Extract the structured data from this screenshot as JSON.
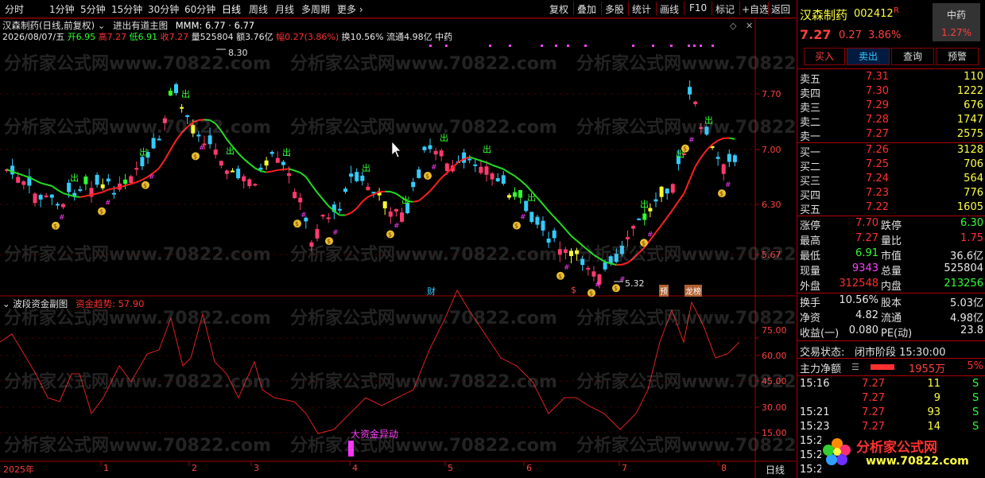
{
  "toolbar": {
    "periods": [
      "分时",
      "1分钟",
      "5分钟",
      "15分钟",
      "30分钟",
      "60分钟",
      "日线",
      "周线",
      "月线",
      "多周期",
      "更多"
    ],
    "active": "日线",
    "right_tools": [
      "复权",
      "叠加",
      "多股",
      "统计",
      "画线",
      "F10",
      "标记",
      "+自选",
      "返回"
    ]
  },
  "chart": {
    "title": "汉森制药(日线,前复权)",
    "indicator_name": "进出有道主图",
    "indicator_values": "MMM: 6.77 · 6.77",
    "info_date": "2026/08/07/五",
    "info_open": "开6.95",
    "info_high": "高7.27",
    "info_low": "低6.91",
    "info_close": "收7.27",
    "info_volume": "量525804",
    "info_amount": "额3.76亿",
    "info_range": "幅0.27(3.86%)",
    "info_turnover": "换10.56%",
    "info_float": "流通4.98亿",
    "info_industry": "中药",
    "y_labels": [
      "7.70",
      "7.00",
      "6.30",
      "5.67"
    ],
    "max_label": "8.30",
    "min_label": "5.32",
    "markers": [
      "财",
      "$",
      "预",
      "龙榜"
    ],
    "signal_chu": "出",
    "signal_money": "$",
    "signal_hash": "#"
  },
  "sub_chart": {
    "name": "波段资金副图",
    "indicator_label": "资金趋势: 57.90",
    "y_labels": [
      "75.00",
      "60.00",
      "45.00",
      "30.00",
      "15.00"
    ],
    "annotation": "大资金异动"
  },
  "x_axis": {
    "labels": [
      "2025年",
      "1",
      "2",
      "3",
      "4",
      "5",
      "6",
      "7",
      "8"
    ],
    "period": "日线"
  },
  "watermark": "分析家公式网www.70822.com",
  "logo": {
    "text": "分析家公式网",
    "url": "www.70822.com"
  },
  "quote": {
    "name": "汉森制药",
    "code": "002412",
    "tag": "R",
    "industry": "中药",
    "industry_pct": "1.27%",
    "price": "7.27",
    "change": "0.27",
    "pct": "3.86%",
    "buttons": [
      "买入",
      "卖出",
      "查询",
      "预警"
    ],
    "asks": [
      {
        "label": "卖五",
        "price": "7.31",
        "vol": "110"
      },
      {
        "label": "卖四",
        "price": "7.30",
        "vol": "1222"
      },
      {
        "label": "卖三",
        "price": "7.29",
        "vol": "676"
      },
      {
        "label": "卖二",
        "price": "7.28",
        "vol": "1747"
      },
      {
        "label": "卖一",
        "price": "7.27",
        "vol": "2575"
      }
    ],
    "bids": [
      {
        "label": "买一",
        "price": "7.26",
        "vol": "3128"
      },
      {
        "label": "买二",
        "price": "7.25",
        "vol": "706"
      },
      {
        "label": "买三",
        "price": "7.24",
        "vol": "564"
      },
      {
        "label": "买四",
        "price": "7.23",
        "vol": "776"
      },
      {
        "label": "买五",
        "price": "7.22",
        "vol": "1605"
      }
    ],
    "stats": [
      {
        "l1": "涨停",
        "v1": "7.70",
        "c1": "red",
        "l2": "跌停",
        "v2": "6.30",
        "c2": "green"
      },
      {
        "l1": "最高",
        "v1": "7.27",
        "c1": "red",
        "l2": "量比",
        "v2": "1.75",
        "c2": "red"
      },
      {
        "l1": "最低",
        "v1": "6.91",
        "c1": "green",
        "l2": "市值",
        "v2": "36.6亿",
        "c2": "white"
      },
      {
        "l1": "现量",
        "v1": "9343",
        "c1": "magenta",
        "l2": "总量",
        "v2": "525804",
        "c2": "white"
      },
      {
        "l1": "外盘",
        "v1": "312548",
        "c1": "red",
        "l2": "内盘",
        "v2": "213256",
        "c2": "green"
      }
    ],
    "stats2": [
      {
        "l1": "换手",
        "v1": "10.56%",
        "l2": "股本",
        "v2": "5.03亿"
      },
      {
        "l1": "净资",
        "v1": "4.82",
        "l2": "流通",
        "v2": "4.98亿"
      },
      {
        "l1": "收益(一)",
        "v1": "0.080",
        "l2": "PE(动)",
        "v2": "23.8"
      }
    ],
    "status_label": "交易状态:",
    "status_value": "闭市阶段 15:30:00",
    "net_label": "主力净额",
    "net_value": "1955万",
    "net_pct": "5%",
    "ticks": [
      {
        "time": "15:16",
        "price": "7.27",
        "vol": "11",
        "dir": "S"
      },
      {
        "time": "",
        "price": "7.27",
        "vol": "9",
        "dir": "S"
      },
      {
        "time": "15:21",
        "price": "7.27",
        "vol": "93",
        "dir": "S"
      },
      {
        "time": "15:23",
        "price": "7.27",
        "vol": "14",
        "dir": "S"
      },
      {
        "time": "15:2",
        "price": "",
        "vol": "",
        "dir": ""
      },
      {
        "time": "15:2",
        "price": "",
        "vol": "",
        "dir": ""
      },
      {
        "time": "15:2",
        "price": "",
        "vol": "",
        "dir": ""
      }
    ]
  },
  "colors": {
    "up": "#ff3a6e",
    "down": "#33ccff",
    "ma_up": "#ff2020",
    "ma_down": "#22dd22",
    "grid": "#a00000"
  }
}
